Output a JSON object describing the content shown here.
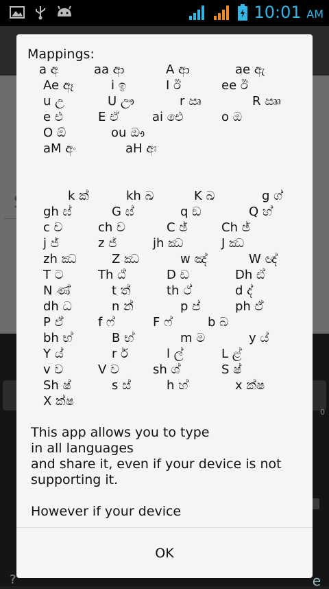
{
  "status_bar": {
    "time": "10:01",
    "ampm": "AM",
    "icons": [
      "image-icon",
      "usb-icon",
      "android-icon",
      "wifi-icon",
      "signal-icon",
      "battery-icon"
    ],
    "accent": "#33b5e5"
  },
  "background": {
    "letter_s": "S",
    "edge_q": "?",
    "edge_e": "e",
    "edge_zero": "0"
  },
  "dialog": {
    "mappings_title": "Mappings:",
    "vowel_rows": [
      [
        "a අ",
        "aa ආ",
        "A ආ",
        "ae ඇ"
      ],
      [
        "Ae ඈ",
        "i ඉ",
        "I ඊ",
        "ee ඊ"
      ],
      [
        "u උ",
        "U ඌ",
        "r ඍ",
        "R ඎ"
      ],
      [
        "e එ",
        "E ඒ",
        "ai ඓ",
        "o ඔ"
      ],
      [
        "O ඕ",
        "ou ඖ"
      ],
      [
        "aM අං",
        "aH අඃ"
      ]
    ],
    "consonant_rows": [
      [
        "k ක්",
        "kh ඛ",
        "K ඛ",
        "g ග්"
      ],
      [
        "gh ඝ්",
        "G ඝ්",
        "q ඞ",
        "Q හ්"
      ],
      [
        "c ච",
        "ch ච",
        "C ඡ්",
        "Ch ඡ්"
      ],
      [
        "j ජ්",
        "z ජ්",
        "jh ඣ",
        "J ඣ"
      ],
      [
        "zh ඣ",
        "Z ඣ",
        "w ඤ්",
        "W ඥ්"
      ],
      [
        "T ට",
        "Th ඨ්",
        "D ඩ",
        "Dh ඪ්"
      ],
      [
        "N ණ්",
        "t ත්",
        "th ථ්",
        "d ද්"
      ],
      [
        "dh ධ",
        "n න්",
        "p ප්",
        "ph ඵ්"
      ],
      [
        "P ඵ්",
        "f ෆ්",
        "F ෆ්",
        "b බ"
      ],
      [
        "bh භ්",
        "B භ්",
        "m ම",
        "y ය්"
      ],
      [
        "Y ය්",
        "r ර්",
        "l ල්",
        "L ළ්"
      ],
      [
        "v ව",
        "V ව",
        "sh ශ්",
        "S ෂ්"
      ],
      [
        "Sh ෂ්",
        "s ස්",
        "h හ්",
        "x ක්ෂ"
      ],
      [
        "X ක්ෂ"
      ]
    ],
    "description_lines": [
      "This app allows you to type",
      "in all languages",
      "and share it, even if your device is not",
      "supporting it.",
      "",
      "However if your device"
    ],
    "ok_label": "OK"
  }
}
